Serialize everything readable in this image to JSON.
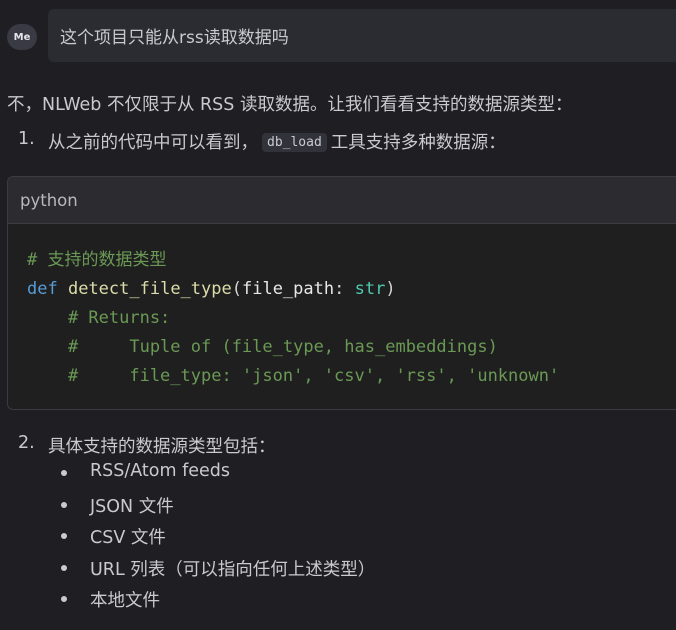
{
  "user": {
    "avatar_label": "Me",
    "message": "这个项目只能从rss读取数据吗"
  },
  "answer": {
    "intro": "不，NLWeb 不仅限于从 RSS 读取数据。让我们看看支持的数据源类型：",
    "items": [
      {
        "number": "1.",
        "text_before": "从之前的代码中可以看到，",
        "code": "db_load",
        "text_after": "工具支持多种数据源："
      },
      {
        "number": "2.",
        "text": "具体支持的数据源类型包括："
      }
    ],
    "code_block": {
      "language": "python",
      "lines": {
        "l1_comment": "# 支持的数据类型",
        "l2_kw": "def",
        "l2_fn": "detect_file_type",
        "l2_open": "(",
        "l2_param": "file_path",
        "l2_colon": ": ",
        "l2_type": "str",
        "l2_close": ")",
        "l3": "    # Returns:",
        "l4": "    #     Tuple of (file_type, has_embeddings)",
        "l5": "    #     file_type: 'json', 'csv', 'rss', 'unknown'"
      }
    },
    "bullets": [
      "RSS/Atom feeds",
      "JSON 文件",
      "CSV 文件",
      "URL 列表（可以指向任何上述类型）",
      "本地文件"
    ]
  },
  "colors": {
    "background": "#1e1e23",
    "text": "#c9c9cf",
    "comment": "#6a9955",
    "keyword": "#569cd6",
    "function": "#dcdcaa",
    "type": "#4ec9b0"
  }
}
